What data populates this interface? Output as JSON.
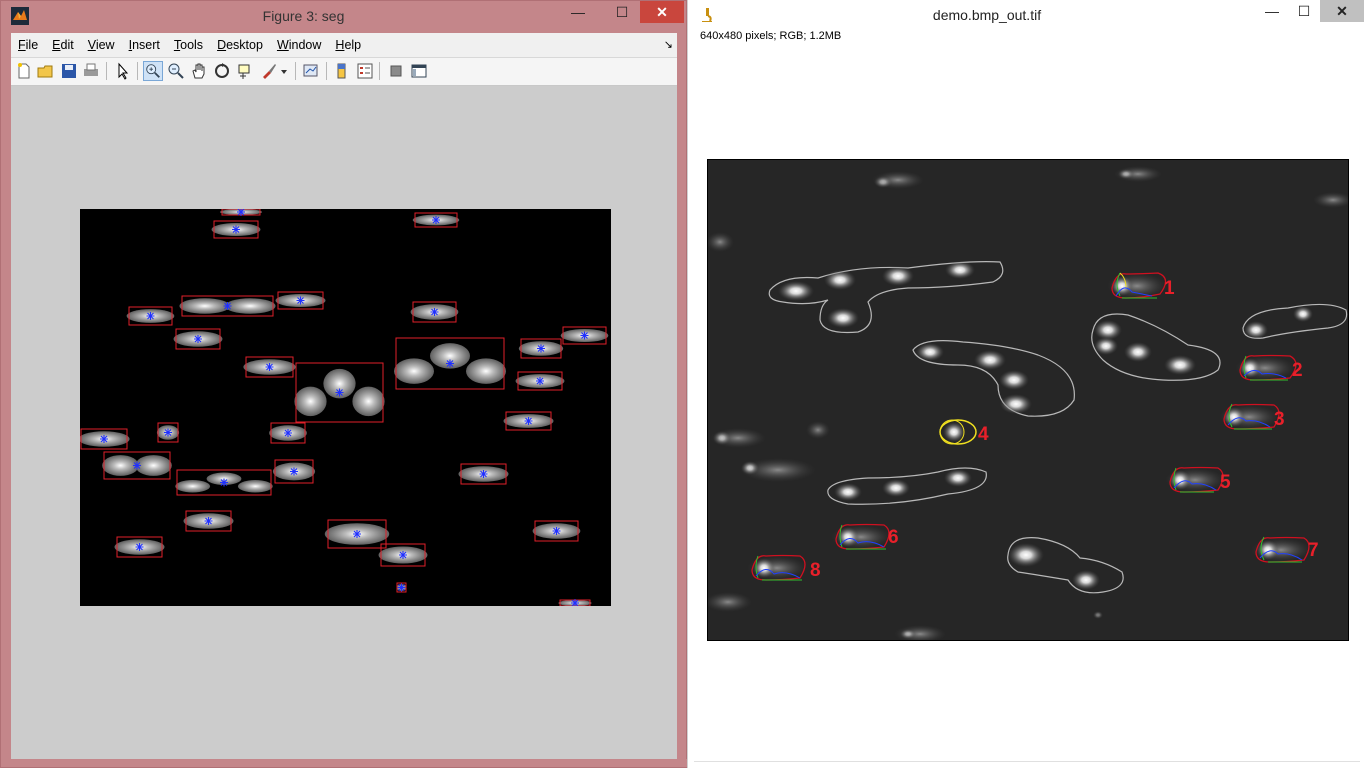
{
  "figure_window": {
    "title": "Figure 3: seg",
    "menu": [
      "File",
      "Edit",
      "View",
      "Insert",
      "Tools",
      "Desktop",
      "Window",
      "Help"
    ],
    "toolbar_icons": [
      "new-figure-icon",
      "open-file-icon",
      "save-icon",
      "print-icon",
      "select-arrow-icon",
      "zoom-in-icon",
      "zoom-out-icon",
      "pan-icon",
      "rotate-3d-icon",
      "data-cursor-icon",
      "brush-icon",
      "brush-dropdown-icon",
      "link-plot-icon",
      "colorbar-icon",
      "legend-icon",
      "hide-plot-tools-icon",
      "show-plot-tools-icon"
    ],
    "controls": {
      "minimize": "—",
      "maximize": "☐",
      "close": "✕"
    }
  },
  "image_window": {
    "title": "demo.bmp_out.tif",
    "info": "640x480 pixels; RGB; 1.2MB",
    "controls": {
      "minimize": "—",
      "maximize": "☐",
      "close": "✕"
    },
    "labels": [
      "1",
      "2",
      "3",
      "4",
      "5",
      "6",
      "7",
      "8"
    ]
  },
  "colors": {
    "window_border": "#c4868a",
    "close_button": "#c9463d",
    "box_outline": "#e0202a",
    "centroid_marker": "#2030ff",
    "annotation_number": "#e8202a",
    "selection_ellipse": "#f0e020",
    "contour": "#b8b8b8"
  }
}
